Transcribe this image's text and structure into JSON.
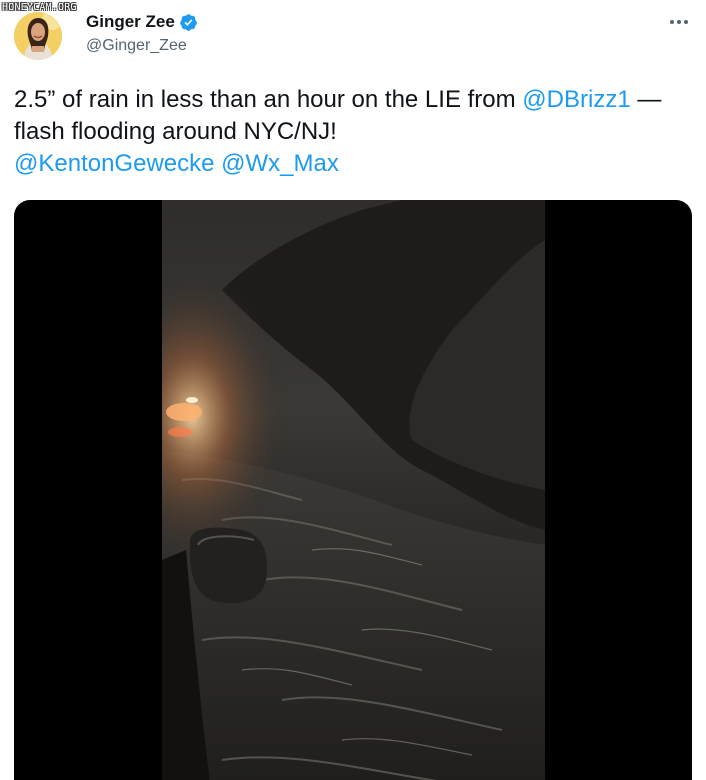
{
  "watermark": "HONEYCAM.ORG",
  "author": {
    "display_name": "Ginger Zee",
    "handle": "@Ginger_Zee",
    "verified": true,
    "avatar_icon": "profile-photo"
  },
  "menu": {
    "icon": "more-horizontal-icon"
  },
  "tweet": {
    "text_1": "2.5” of rain in less than an hour on the LIE from ",
    "mention_1": "@DBrizz1",
    "text_2": " — flash flooding around NYC/NJ!",
    "mention_2": "@KentonGewecke",
    "text_3": " ",
    "mention_3": "@Wx_Max"
  },
  "media": {
    "type": "video",
    "description_icon": "flood-video-frame"
  },
  "colors": {
    "accent": "#1d9bf0",
    "text": "#0f1419",
    "secondary": "#536471",
    "media_bg": "#000000"
  }
}
